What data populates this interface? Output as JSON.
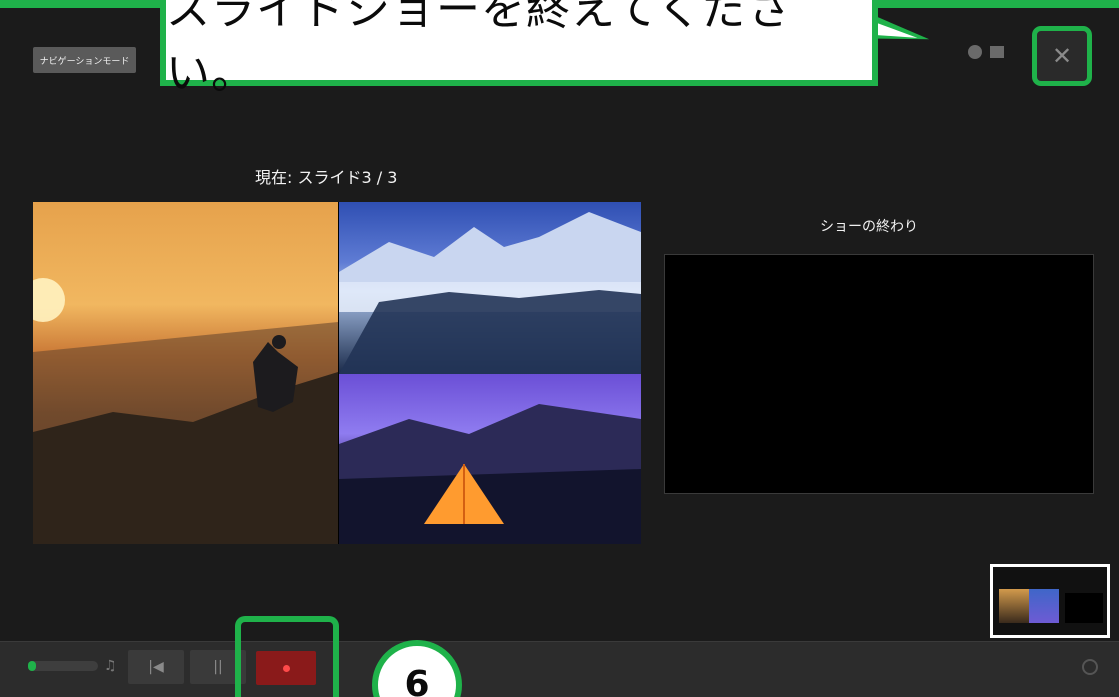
{
  "callout": {
    "text": "スライドショーを終えてください。"
  },
  "header": {
    "nav_chip_label": "ナビゲーションモード"
  },
  "slide": {
    "current_label": "現在: スライド3 / 3"
  },
  "end_panel": {
    "title": "ショーの終わり"
  },
  "toolbar": {
    "step_number": "6"
  },
  "colors": {
    "accent": "#1fb24a",
    "record": "#8a1a1a",
    "background": "#1b1b1b"
  },
  "icons": {
    "close": "close-icon",
    "record": "record-icon",
    "pause": "pause-icon",
    "previous": "previous-icon",
    "microphone": "microphone-icon",
    "volume": "volume-slider"
  }
}
